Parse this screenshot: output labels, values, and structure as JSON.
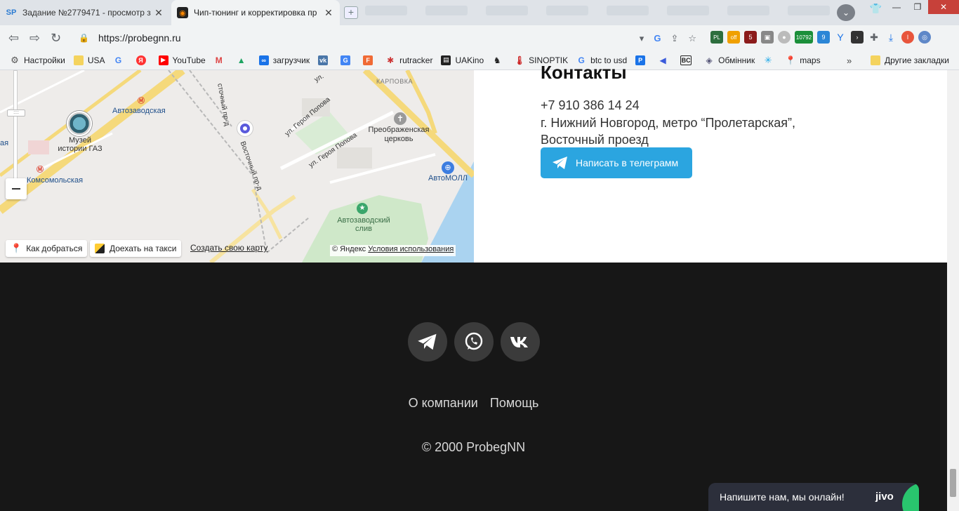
{
  "browser": {
    "tabs": [
      {
        "title": "Задание №2779471 - просмотр з",
        "favicon": "SP",
        "active": false
      },
      {
        "title": "Чип-тюнинг и корректировка пр",
        "favicon": "flame-icon",
        "active": true
      }
    ],
    "url": "https://probegnn.ru",
    "bookmarks": [
      {
        "label": "Настройки",
        "icon": "gear-icon"
      },
      {
        "label": "USA",
        "icon": "folder-icon"
      },
      {
        "label": "",
        "icon": "google-icon"
      },
      {
        "label": "",
        "icon": "yandex-icon"
      },
      {
        "label": "YouTube",
        "icon": "youtube-icon"
      },
      {
        "label": "",
        "icon": "gmail-icon"
      },
      {
        "label": "",
        "icon": "drive-icon"
      },
      {
        "label": "загрузчик",
        "icon": "infinity-icon"
      },
      {
        "label": "",
        "icon": "vk-icon"
      },
      {
        "label": "",
        "icon": "translate-icon"
      },
      {
        "label": "",
        "icon": "f-icon"
      },
      {
        "label": "rutracker",
        "icon": "rutracker-icon"
      },
      {
        "label": "UAKino",
        "icon": "uakino-icon"
      },
      {
        "label": "",
        "icon": "chess-icon"
      },
      {
        "label": "SINOPTIK",
        "icon": "thermometer-icon"
      },
      {
        "label": "btc to usd",
        "icon": "google-icon"
      },
      {
        "label": "",
        "icon": "p-icon"
      },
      {
        "label": "",
        "icon": "arrow-icon"
      },
      {
        "label": "",
        "icon": "bc-icon"
      },
      {
        "label": "Обмінник",
        "icon": "layers-icon"
      },
      {
        "label": "",
        "icon": "star-icon"
      },
      {
        "label": "maps",
        "icon": "maps-pin-icon"
      }
    ],
    "bookmarks_more": "»",
    "other_bookmarks": "Другие закладки",
    "ext_badges": {
      "pl": "PL",
      "off": "off",
      "five": "5",
      "count": "10792",
      "nine": "9"
    }
  },
  "map": {
    "labels": {
      "metro_avtozavodskaya": "Автозаводская",
      "museum": "Музей истории ГАЗ",
      "metro_komsomolskaya": "Комсомольская",
      "street_vostochny": "Восточный пр-д",
      "street_vostochny_top": "сточный пр-д",
      "street_geroya_1": "ул. Героя Попова",
      "street_geroya_2": "ул. Героя Попова",
      "karpovka": "КАРПОВКА",
      "church": "Преображенская церковь",
      "mall": "АвтоМОЛЛ",
      "park": "Автозаводский слив",
      "edge_left": "ая",
      "street_ul": "ул."
    },
    "route_button": "Как добраться",
    "taxi_button": "Доехать на такси",
    "create_map_link": "Создать свою карту",
    "copyright_prefix": "© Яндекс",
    "terms_link": "Условия использования"
  },
  "contacts": {
    "title": "Контакты",
    "phone": "+7 910 386 14 24",
    "address_line1": "г. Нижний Новгород, метро “Пролетарская”,",
    "address_line2": "Восточный проезд",
    "telegram_button": "Написать в телеграмм"
  },
  "footer": {
    "links": [
      "О компании",
      "Помощь"
    ],
    "copyright": "© 2000 ProbegNN"
  },
  "chat": {
    "text": "Напишите нам, мы онлайн!",
    "brand": "jivo"
  },
  "colors": {
    "telegram_blue": "#2ba5e0",
    "footer_bg": "#171717",
    "chat_bg": "#2c2f3b",
    "chat_green": "#29c56e"
  }
}
